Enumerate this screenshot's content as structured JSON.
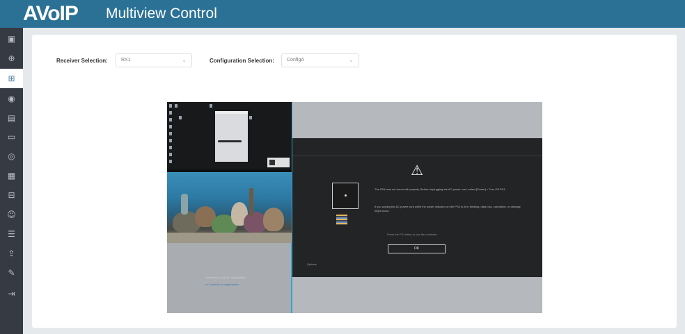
{
  "header": {
    "logo": "AVoIP",
    "title": "Multiview Control"
  },
  "sidebar": {
    "items": [
      {
        "icon": "dashboard-icon",
        "glyph": "▣",
        "active": false
      },
      {
        "icon": "plus-circle-icon",
        "glyph": "⊕",
        "active": false
      },
      {
        "icon": "multiview-icon",
        "glyph": "⊞",
        "active": true
      },
      {
        "icon": "layers-icon",
        "glyph": "◉",
        "active": false
      },
      {
        "icon": "display-icon",
        "glyph": "▤",
        "active": false
      },
      {
        "icon": "monitor-icon",
        "glyph": "▭",
        "active": false
      },
      {
        "icon": "settings-icon",
        "glyph": "◎",
        "active": false
      },
      {
        "icon": "grid-icon",
        "glyph": "▦",
        "active": false
      },
      {
        "icon": "table-icon",
        "glyph": "⊟",
        "active": false
      },
      {
        "icon": "user-icon",
        "glyph": "☺",
        "active": false
      },
      {
        "icon": "sliders-icon",
        "glyph": "☰",
        "active": false
      },
      {
        "icon": "upload-icon",
        "glyph": "⇪",
        "active": false
      },
      {
        "icon": "wrench-icon",
        "glyph": "✎",
        "active": false
      },
      {
        "icon": "logout-icon",
        "glyph": "⇥",
        "active": false
      }
    ]
  },
  "controls": {
    "receiver_label": "Receiver Selection:",
    "receiver_value": "RX1",
    "config_label": "Configuration Selection:",
    "config_value": "ConfigA"
  },
  "preview": {
    "dialog": {
      "message": "The PS4 was not turned off properly. Before unplugging the AC power cord, select [Power] > Turn Off PS4.",
      "message2": "If you unplug the AC power cord while the power indicator on the PS4 is lit or blinking, data loss, corruption, or damage might occur.",
      "hint": "Press the PS button to use the controller.",
      "ok_label": "OK",
      "options_label": "Options"
    },
    "q3": {
      "line1": "Subscribe or pay an organization",
      "line2": "or Continue to organization"
    }
  }
}
